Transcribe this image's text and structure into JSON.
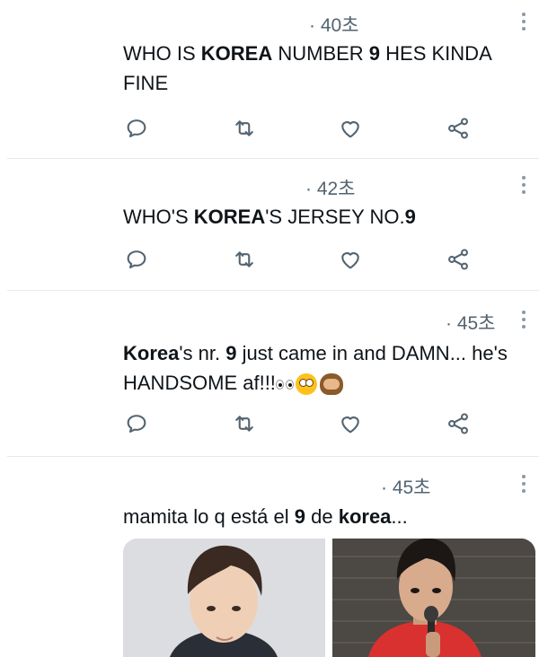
{
  "tweets": [
    {
      "time": "· 40초",
      "text": [
        {
          "t": "WHO IS ",
          "b": false
        },
        {
          "t": "KOREA",
          "b": true
        },
        {
          "t": " NUMBER ",
          "b": false
        },
        {
          "t": "9",
          "b": true
        },
        {
          "t": " HES KINDA FINE",
          "b": false
        }
      ]
    },
    {
      "time": "· 42초",
      "text": [
        {
          "t": "WHO'S ",
          "b": false
        },
        {
          "t": "KOREA",
          "b": true
        },
        {
          "t": "'S JERSEY NO.",
          "b": false
        },
        {
          "t": "9",
          "b": true
        }
      ]
    },
    {
      "time": "· 45초",
      "text": [
        {
          "t": "Korea",
          "b": true
        },
        {
          "t": "'s nr. ",
          "b": false
        },
        {
          "t": "9",
          "b": true
        },
        {
          "t": " just came in and DAMN... he's HANDSOME af!!!",
          "b": false
        }
      ],
      "emojis": [
        "eyes-emoji",
        "flushed-face-emoji",
        "see-no-evil-monkey-emoji"
      ]
    },
    {
      "time": "· 45초",
      "text": [
        {
          "t": "mamita lo q está el ",
          "b": false
        },
        {
          "t": "9",
          "b": true
        },
        {
          "t": " de ",
          "b": false
        },
        {
          "t": "korea",
          "b": true
        },
        {
          "t": "...",
          "b": false
        }
      ],
      "media": [
        "player-portrait-photo",
        "player-press-conference-photo"
      ]
    }
  ],
  "icons": {
    "reply": "reply-icon",
    "retweet": "retweet-icon",
    "like": "heart-icon",
    "share": "share-icon",
    "more": "more-options-icon"
  },
  "colors": {
    "text": "#0f1419",
    "secondary": "#536471",
    "icon": "#536471",
    "divider": "#e6e9ec"
  }
}
